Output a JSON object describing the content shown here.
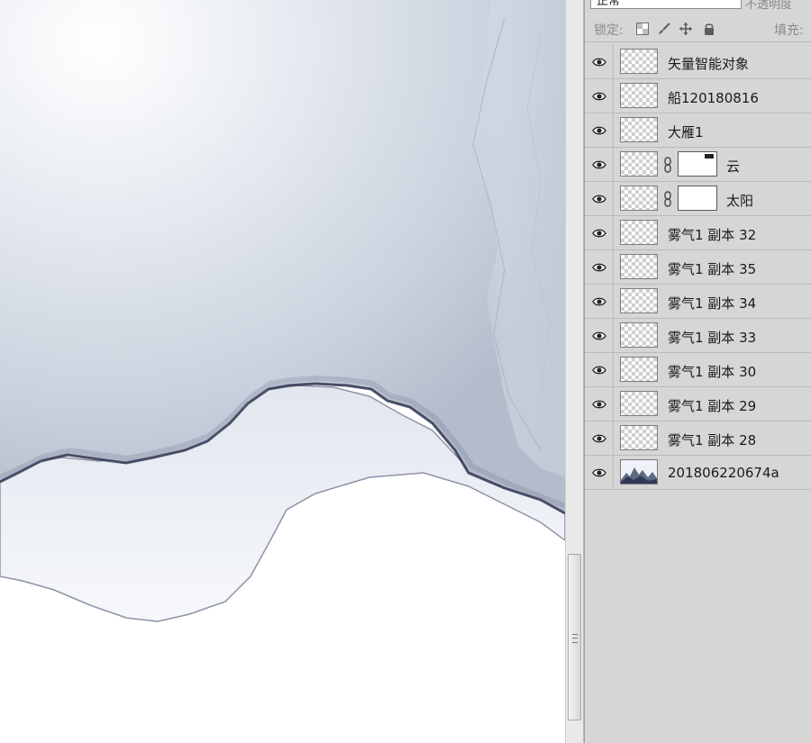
{
  "panel": {
    "blend_mode": "正常",
    "opacity_label": "不透明度",
    "lock_label": "锁定:",
    "fill_label": "填充:",
    "lock_icons": [
      "lock-transparent-icon",
      "lock-brush-icon",
      "lock-move-icon",
      "lock-all-icon"
    ]
  },
  "layers": [
    {
      "name": "矢量智能对象",
      "visible": true,
      "mask": false
    },
    {
      "name": "船120180816",
      "visible": true,
      "mask": false
    },
    {
      "name": "大雁1",
      "visible": true,
      "mask": false
    },
    {
      "name": "云",
      "visible": true,
      "mask": true
    },
    {
      "name": "太阳",
      "visible": true,
      "mask": true
    },
    {
      "name": "雾气1 副本 32",
      "visible": true,
      "mask": false
    },
    {
      "name": "雾气1 副本 35",
      "visible": true,
      "mask": false
    },
    {
      "name": "雾气1 副本 34",
      "visible": true,
      "mask": false
    },
    {
      "name": "雾气1 副本 33",
      "visible": true,
      "mask": false
    },
    {
      "name": "雾气1 副本 30",
      "visible": true,
      "mask": false
    },
    {
      "name": "雾气1 副本 29",
      "visible": true,
      "mask": false
    },
    {
      "name": "雾气1 副本 28",
      "visible": true,
      "mask": false
    },
    {
      "name": "201806220674a",
      "visible": true,
      "mask": false,
      "image": true
    }
  ],
  "colors": {
    "panel_bg": "#d6d6d6",
    "ink_dark": "#2f3550",
    "wash_light": "#e4e8ef"
  }
}
